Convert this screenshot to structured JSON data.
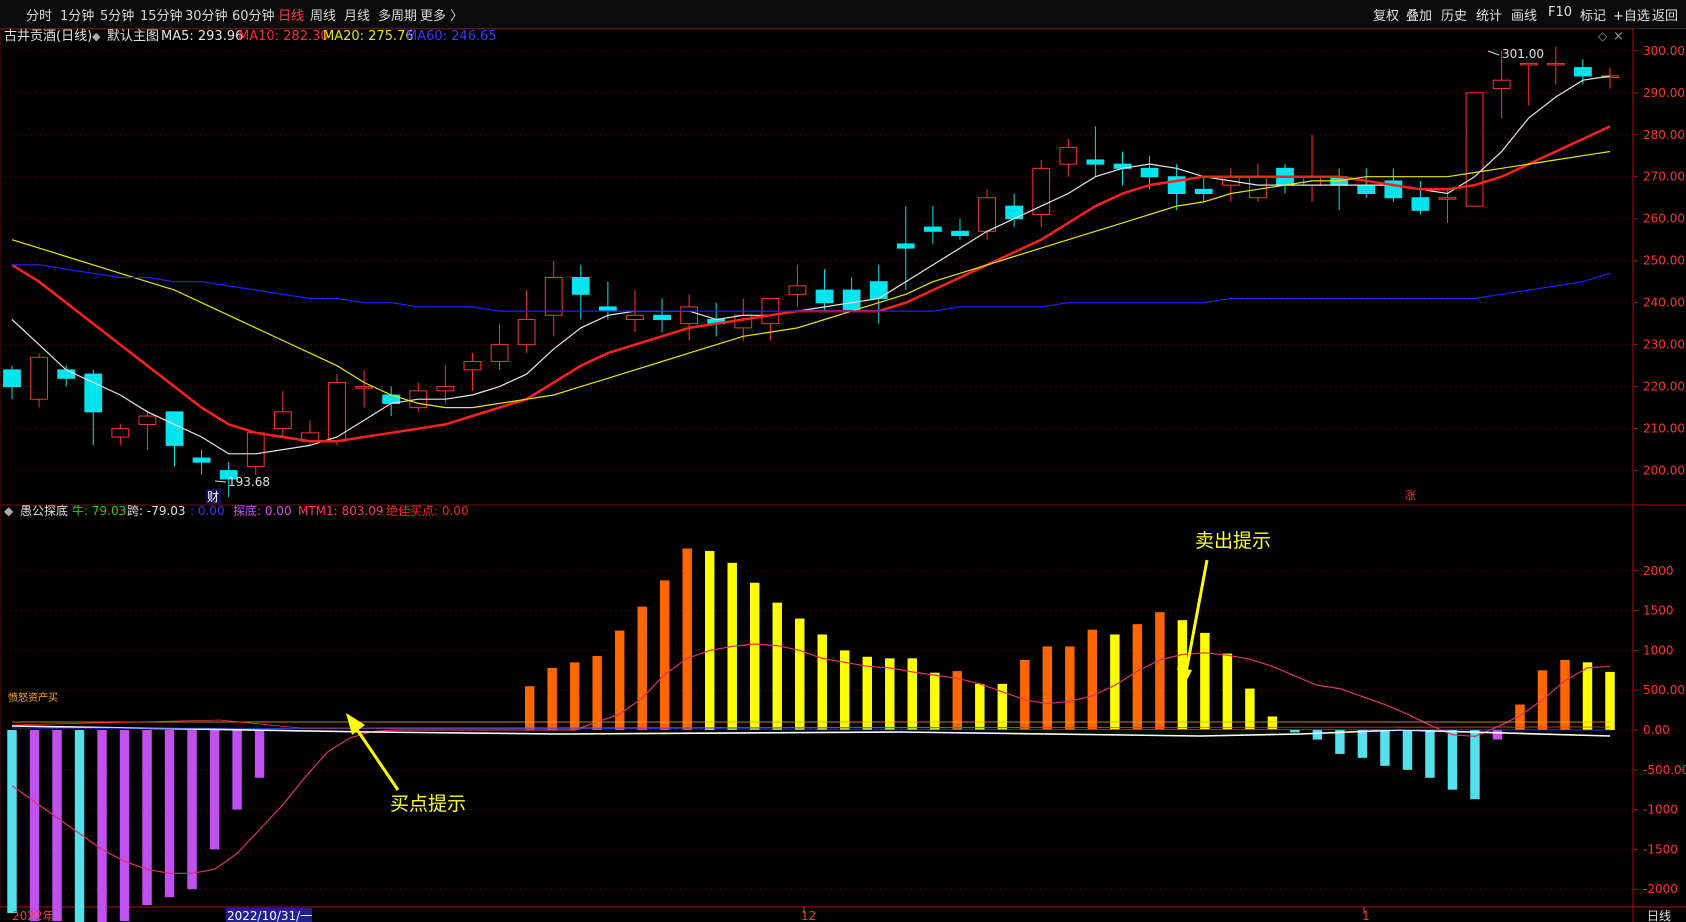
{
  "toolbar": {
    "left": [
      "分时",
      "1分钟",
      "5分钟",
      "15分钟",
      "30分钟",
      "60分钟",
      "日线",
      "周线",
      "月线",
      "多周期",
      "更多 〉"
    ],
    "active": "日线",
    "right": [
      "复权",
      "叠加",
      "历史",
      "统计",
      "画线",
      "F10",
      "标记",
      "+自选",
      "返回"
    ]
  },
  "main_header": {
    "stock": "古井贡酒(日线)",
    "template": "默认主图",
    "ma5": "MA5: 293.96",
    "ma10": "MA10: 282.30",
    "ma20": "MA20: 275.76",
    "ma60": "MA60: 246.65"
  },
  "indicator_header": {
    "name": "愚公探底",
    "bull": "牛: 79.03",
    "bear": "跨: -79.03",
    "blank": ": 0.00",
    "probe": "探底: 0.00",
    "mtm": "MTM1: 803.09",
    "best_buy": "绝佳买点: 0.00"
  },
  "annotations": {
    "sell": "卖出提示",
    "buy": "买点提示",
    "high_label": "301.00",
    "low_label": "193.68",
    "fin_marker": "财",
    "up_marker": "涨",
    "legend_small": "愤怒资产买"
  },
  "xaxis": {
    "year": "2022年",
    "cursor_date": "2022/10/31/一",
    "dec": "12",
    "jan": "1",
    "period": "日线"
  },
  "colors": {
    "up": "#ff3333",
    "down": "#00e5ee",
    "ma5": "#e6e6e6",
    "ma10": "#ff2020",
    "ma20": "#e6e600",
    "ma60": "#2020ff",
    "orange": "#ff6600",
    "yellow": "#ffff00",
    "purple": "#c050f0",
    "cyan": "#55e0ee"
  },
  "chart_data": [
    {
      "type": "candlestick",
      "title": "古井贡酒(日线)",
      "ylim": [
        193,
        304
      ],
      "yticks": [
        200,
        210,
        220,
        230,
        240,
        250,
        260,
        270,
        280,
        290,
        300
      ],
      "ytick_labels": [
        "200.00",
        "210.00",
        "220.00",
        "230.00",
        "240.00",
        "250.00",
        "260.00",
        "270.00",
        "280.00",
        "290.00",
        "300.00"
      ],
      "ohlc": [
        [
          224,
          225,
          217,
          220
        ],
        [
          217,
          228,
          215,
          227
        ],
        [
          224,
          225,
          220,
          222
        ],
        [
          223,
          224,
          206,
          214
        ],
        [
          208,
          211,
          206,
          210
        ],
        [
          211,
          214,
          205,
          213
        ],
        [
          214,
          214,
          201,
          206
        ],
        [
          203,
          205,
          199,
          202
        ],
        [
          200,
          202,
          193.68,
          198
        ],
        [
          201,
          209,
          199,
          209
        ],
        [
          210,
          219,
          208,
          214
        ],
        [
          207,
          212,
          206,
          209
        ],
        [
          207,
          223,
          206,
          221
        ],
        [
          220,
          224,
          215,
          220
        ],
        [
          218,
          220,
          213,
          216
        ],
        [
          215,
          221,
          214,
          219
        ],
        [
          219,
          225,
          216,
          220
        ],
        [
          224,
          228,
          219,
          226
        ],
        [
          226,
          235,
          224,
          230
        ],
        [
          230,
          243,
          228,
          236
        ],
        [
          237,
          250,
          232,
          246
        ],
        [
          246,
          249,
          236,
          242
        ],
        [
          239,
          245,
          236,
          238
        ],
        [
          236,
          243,
          233,
          237
        ],
        [
          237,
          241,
          233,
          236
        ],
        [
          235,
          242,
          231,
          239
        ],
        [
          236,
          240,
          232,
          235
        ],
        [
          234,
          241,
          231,
          237
        ],
        [
          235,
          240,
          231,
          241
        ],
        [
          242,
          249,
          239,
          244
        ],
        [
          243,
          248,
          238,
          240
        ],
        [
          243,
          246,
          238,
          238
        ],
        [
          245,
          249,
          235,
          241
        ],
        [
          254,
          263,
          243,
          253
        ],
        [
          258,
          263,
          254,
          257
        ],
        [
          257,
          260,
          255,
          256
        ],
        [
          257,
          267,
          255,
          265
        ],
        [
          263,
          266,
          258,
          260
        ],
        [
          261,
          274,
          258,
          272
        ],
        [
          273,
          279,
          270,
          277
        ],
        [
          274,
          282,
          270,
          273
        ],
        [
          273,
          276,
          268,
          272
        ],
        [
          272,
          275,
          267,
          270
        ],
        [
          270,
          273,
          262,
          266
        ],
        [
          267,
          270,
          264,
          266
        ],
        [
          268,
          272,
          264,
          270
        ],
        [
          265,
          273,
          264,
          270
        ],
        [
          272,
          273,
          266,
          268
        ],
        [
          268,
          280,
          264,
          270
        ],
        [
          270,
          272,
          262,
          268
        ],
        [
          268,
          272,
          265,
          266
        ],
        [
          269,
          272,
          264,
          265
        ],
        [
          265,
          269,
          261,
          262
        ],
        [
          265,
          267,
          259,
          265
        ],
        [
          263,
          290,
          263,
          290
        ],
        [
          291,
          300,
          284,
          293
        ],
        [
          297,
          297,
          287,
          297
        ],
        [
          297,
          301,
          292,
          297
        ],
        [
          296,
          298,
          292,
          294
        ],
        [
          294,
          296,
          291,
          294
        ]
      ],
      "series": [
        {
          "name": "MA5",
          "values": [
            236,
            230,
            224,
            221,
            218,
            214,
            211,
            208,
            204,
            204,
            205,
            206,
            208,
            212,
            216,
            217,
            217,
            218,
            220,
            223,
            229,
            234,
            237,
            238,
            238,
            238,
            236,
            237,
            237,
            238,
            239,
            240,
            241,
            245,
            249,
            253,
            257,
            260,
            263,
            266,
            270,
            272,
            273,
            272,
            270,
            269,
            268,
            268,
            268,
            268,
            268,
            268,
            267,
            266,
            270,
            276,
            284,
            289,
            293,
            294
          ]
        },
        {
          "name": "MA10",
          "values": [
            249,
            245,
            240,
            235,
            230,
            225,
            220,
            215,
            211,
            209,
            208,
            207,
            207,
            208,
            209,
            210,
            211,
            213,
            215,
            217,
            221,
            225,
            228,
            230,
            232,
            234,
            235,
            236,
            237,
            238,
            238,
            238,
            238,
            240,
            243,
            246,
            249,
            252,
            255,
            259,
            263,
            266,
            268,
            269,
            270,
            270,
            270,
            270,
            270,
            270,
            269,
            268,
            267,
            267,
            268,
            270,
            273,
            276,
            279,
            282
          ]
        },
        {
          "name": "MA20",
          "values": [
            255,
            253,
            251,
            249,
            247,
            245,
            243,
            240,
            237,
            234,
            231,
            228,
            225,
            221,
            218,
            216,
            215,
            215,
            216,
            217,
            218,
            220,
            222,
            224,
            226,
            228,
            230,
            232,
            233,
            234,
            236,
            238,
            240,
            242,
            245,
            247,
            249,
            251,
            253,
            255,
            257,
            259,
            261,
            263,
            264,
            266,
            267,
            268,
            269,
            269,
            270,
            270,
            270,
            270,
            271,
            272,
            273,
            274,
            275,
            276
          ]
        },
        {
          "name": "MA60",
          "values": [
            249,
            249,
            248,
            247,
            246,
            246,
            245,
            245,
            244,
            243,
            242,
            241,
            241,
            240,
            240,
            239,
            239,
            239,
            238,
            238,
            238,
            238,
            238,
            238,
            238,
            238,
            238,
            238,
            238,
            238,
            238,
            238,
            238,
            238,
            238,
            239,
            239,
            239,
            239,
            240,
            240,
            240,
            240,
            240,
            240,
            241,
            241,
            241,
            241,
            241,
            241,
            241,
            241,
            241,
            241,
            242,
            243,
            244,
            245,
            247
          ]
        }
      ]
    },
    {
      "type": "bar",
      "title": "愚公探底",
      "ylim": [
        -2600,
        2600
      ],
      "yticks": [
        2000,
        1500,
        1000,
        500,
        0,
        -500,
        -1000,
        -1500,
        -2000
      ],
      "ytick_labels": [
        "2000",
        "1500",
        "1000",
        "500.00",
        "0.00",
        "-500.00",
        "-1000",
        "-1500",
        "-2000"
      ],
      "values": [
        -2300,
        -2400,
        -2400,
        -2500,
        -2500,
        -2400,
        -2200,
        -2100,
        -2000,
        -1500,
        -1000,
        -600,
        0,
        0,
        0,
        0,
        0,
        0,
        0,
        0,
        0,
        0,
        0,
        550,
        780,
        850,
        930,
        1250,
        1550,
        1880,
        2280,
        2250,
        2100,
        1850,
        1600,
        1400,
        1200,
        1000,
        920,
        900,
        900,
        720,
        740,
        580,
        580,
        880,
        1050,
        1050,
        1260,
        1200,
        1330,
        1480,
        1380,
        1220,
        960,
        520,
        170,
        -30,
        -120,
        -300,
        -350,
        -450,
        -500,
        -600,
        -750,
        -870,
        -120,
        320,
        750,
        880,
        850,
        730
      ],
      "colors_by_bar": [
        "cyan",
        "purple",
        "purple",
        "cyan",
        "purple",
        "purple",
        "purple",
        "purple",
        "purple",
        "purple",
        "purple",
        "purple",
        "none",
        "none",
        "none",
        "none",
        "none",
        "none",
        "none",
        "none",
        "none",
        "none",
        "none",
        "orange",
        "orange",
        "orange",
        "orange",
        "orange",
        "orange",
        "orange",
        "orange",
        "yellow",
        "yellow",
        "yellow",
        "yellow",
        "yellow",
        "yellow",
        "yellow",
        "yellow",
        "yellow",
        "yellow",
        "yellow",
        "orange",
        "yellow",
        "yellow",
        "orange",
        "orange",
        "orange",
        "orange",
        "yellow",
        "orange",
        "orange",
        "yellow",
        "yellow",
        "yellow",
        "yellow",
        "yellow",
        "cyan",
        "cyan",
        "cyan",
        "cyan",
        "cyan",
        "cyan",
        "cyan",
        "cyan",
        "cyan",
        "purple",
        "orange",
        "orange",
        "orange",
        "yellow",
        "yellow"
      ],
      "series": [
        {
          "name": "MTM1",
          "values": [
            -700,
            -900,
            -1100,
            -1300,
            -1500,
            -1650,
            -1750,
            -1800,
            -1800,
            -1750,
            -1550,
            -1250,
            -950,
            -600,
            -280,
            -100,
            -20,
            0,
            0,
            0,
            0,
            0,
            0,
            0,
            0,
            0,
            100,
            200,
            400,
            700,
            900,
            1000,
            1050,
            1080,
            1060,
            1000,
            900,
            850,
            800,
            780,
            730,
            690,
            650,
            580,
            480,
            380,
            330,
            360,
            430,
            560,
            740,
            880,
            950,
            970,
            940,
            890,
            800,
            680,
            560,
            520,
            420,
            320,
            200,
            60,
            -60,
            -80,
            40,
            180,
            380,
            620,
            780,
            800
          ]
        }
      ]
    }
  ]
}
